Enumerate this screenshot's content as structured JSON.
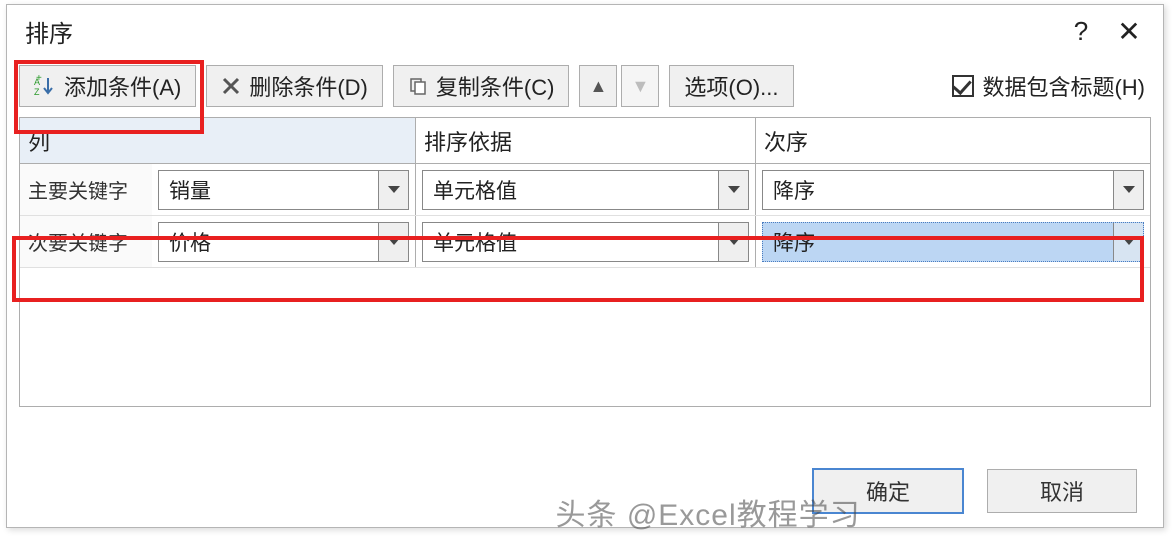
{
  "title": "排序",
  "toolbar": {
    "add": "添加条件(A)",
    "delete": "删除条件(D)",
    "copy": "复制条件(C)",
    "options": "选项(O)...",
    "headers_label": "数据包含标题(H)",
    "headers_checked": true
  },
  "headers": {
    "col": "列",
    "sort_on": "排序依据",
    "order": "次序"
  },
  "rows": [
    {
      "label": "主要关键字",
      "column": "销量",
      "sort_on": "单元格值",
      "order": "降序",
      "order_selected": false
    },
    {
      "label": "次要关键字",
      "column": "价格",
      "sort_on": "单元格值",
      "order": "降序",
      "order_selected": true
    }
  ],
  "footer": {
    "ok": "确定",
    "cancel": "取消"
  },
  "watermark": "头条 @Excel教程学习"
}
